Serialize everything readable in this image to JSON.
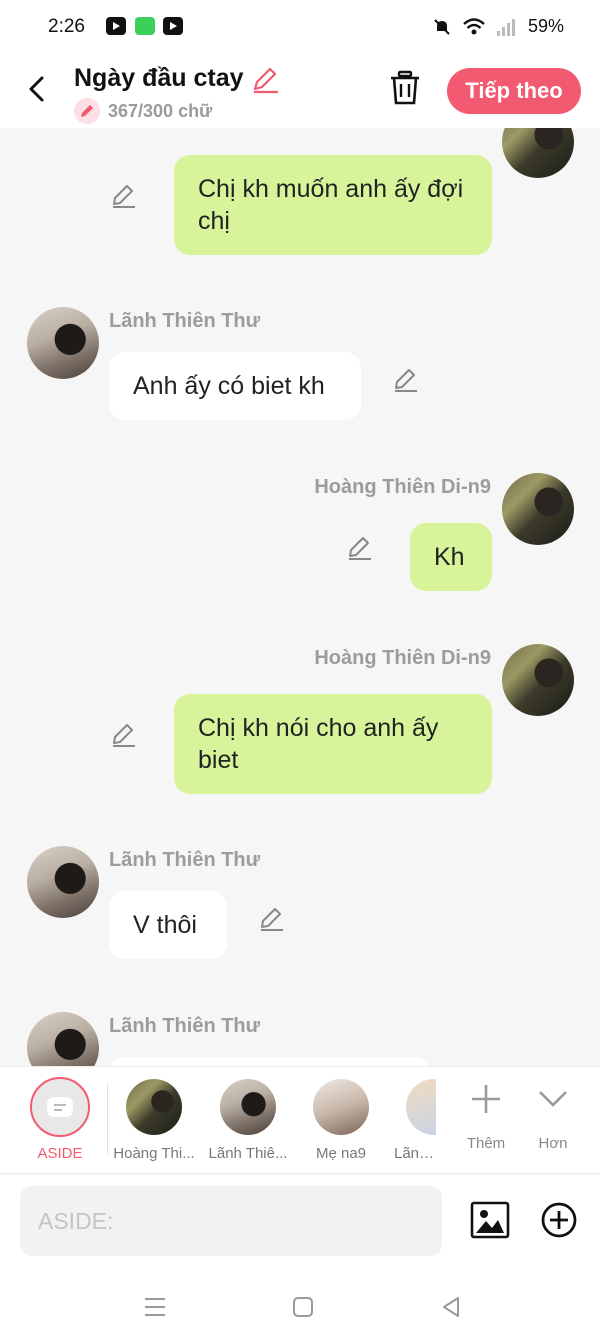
{
  "status_bar": {
    "time": "2:26",
    "battery": "59%"
  },
  "header": {
    "title": "Ngày đầu ctay",
    "word_count": "367/300 chữ",
    "next_label": "Tiếp theo"
  },
  "messages": [
    {
      "side": "right",
      "name": "",
      "text": "Chị kh muốn anh ấy đợi chị"
    },
    {
      "side": "left",
      "name": "Lãnh Thiên Thư",
      "text": "Anh ấy có biet kh"
    },
    {
      "side": "right",
      "name": "Hoàng Thiên Di-n9",
      "text": "Kh"
    },
    {
      "side": "right",
      "name": "Hoàng Thiên Di-n9",
      "text": "Chị kh nói cho anh ấy biet"
    },
    {
      "side": "left",
      "name": "Lãnh Thiên Thư",
      "text": "V thôi"
    },
    {
      "side": "left",
      "name": "Lãnh Thiên Thư",
      "text": ""
    }
  ],
  "characters": {
    "aside_label": "ASIDE",
    "items": [
      {
        "label": "Hoàng Thi..."
      },
      {
        "label": "Lãnh Thiê..."
      },
      {
        "label": "Mẹ na9"
      },
      {
        "label": "Lãnh T"
      }
    ],
    "more_label": "Thêm",
    "collapse_label": "Hơn"
  },
  "composer": {
    "placeholder": "ASIDE:"
  },
  "colors": {
    "accent": "#f25a71",
    "bubble_green": "#d8f49b",
    "bubble_white": "#ffffff"
  }
}
